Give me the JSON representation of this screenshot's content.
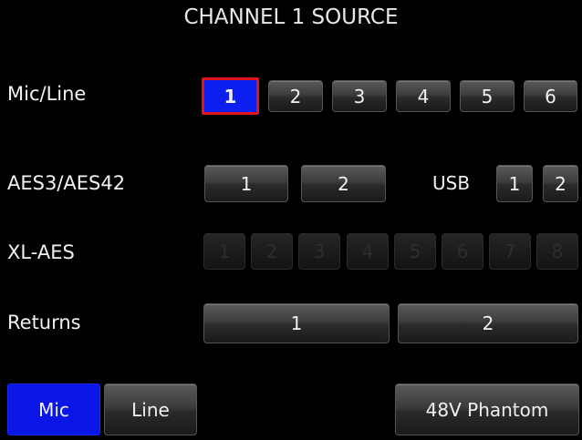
{
  "title": "CHANNEL 1 SOURCE",
  "rows": {
    "mic_line": {
      "label": "Mic/Line",
      "buttons": [
        "1",
        "2",
        "3",
        "4",
        "5",
        "6"
      ],
      "selected": "1"
    },
    "aes": {
      "label": "AES3/AES42",
      "buttons": [
        "1",
        "2"
      ]
    },
    "usb": {
      "label": "USB",
      "buttons": [
        "1",
        "2"
      ]
    },
    "xl_aes": {
      "label": "XL-AES",
      "buttons": [
        "1",
        "2",
        "3",
        "4",
        "5",
        "6",
        "7",
        "8"
      ],
      "enabled": false
    },
    "returns": {
      "label": "Returns",
      "buttons": [
        "1",
        "2"
      ]
    }
  },
  "bottom": {
    "mic_label": "Mic",
    "line_label": "Line",
    "active_mode": "Mic",
    "phantom_label": "48V Phantom"
  },
  "colors": {
    "background": "#000000",
    "selected_fill": "#0c1ef0",
    "selected_border": "#e3141c",
    "mode_active_fill": "#0a16e6"
  }
}
